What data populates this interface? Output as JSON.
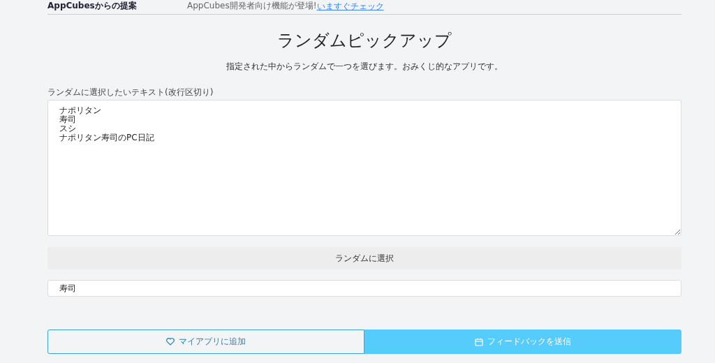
{
  "suggestion": {
    "label": "AppCubesからの提案",
    "text": "AppCubes開発者向け機能が登場!",
    "link": "いますぐチェック"
  },
  "title": "ランダムピックアップ",
  "description": "指定された中からランダムで一つを選びます。おみくじ的なアプリです。",
  "input": {
    "label": "ランダムに選択したいテキスト(改行区切り)",
    "lines": [
      "ナポリタン",
      "寿司",
      "スシ",
      "ナポリタン寿司のPC日記"
    ]
  },
  "pick_button": "ランダムに選択",
  "result": {
    "value": "寿司"
  },
  "actions": [
    {
      "kind": "favorite",
      "label": "マイアプリに追加"
    },
    {
      "kind": "feedback",
      "label": "フィードバックを送信"
    }
  ]
}
